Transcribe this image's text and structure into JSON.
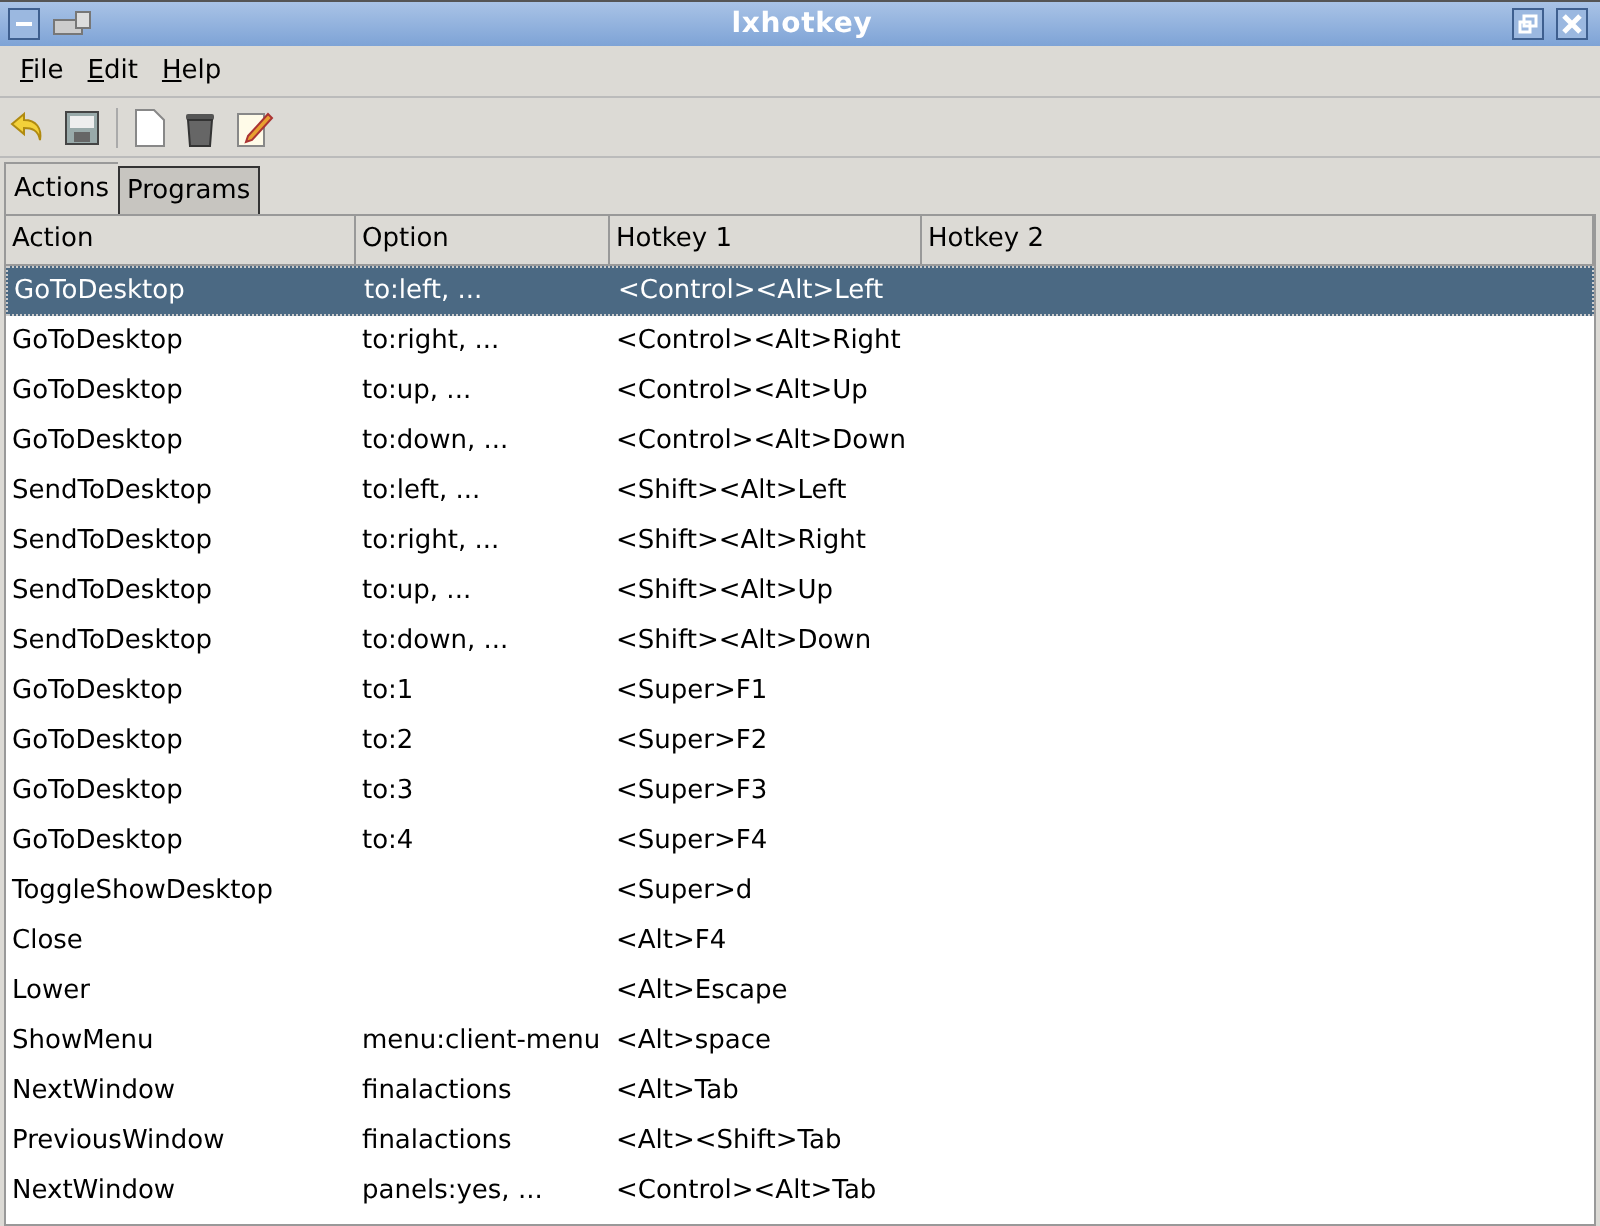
{
  "window": {
    "title": "lxhotkey"
  },
  "menu": [
    "File",
    "Edit",
    "Help"
  ],
  "tabs": [
    {
      "label": "Actions",
      "selected": true
    },
    {
      "label": "Programs",
      "selected": false
    }
  ],
  "table": {
    "columns": [
      "Action",
      "Option",
      "Hotkey 1",
      "Hotkey 2"
    ],
    "rows": [
      {
        "cells": [
          "GoToDesktop",
          "to:left, ...",
          "<Control><Alt>Left"
        ],
        "selected": true
      },
      {
        "cells": [
          "GoToDesktop",
          "to:right, ...",
          "<Control><Alt>Right"
        ],
        "selected": false
      },
      {
        "cells": [
          "GoToDesktop",
          "to:up, ...",
          "<Control><Alt>Up"
        ],
        "selected": false
      },
      {
        "cells": [
          "GoToDesktop",
          "to:down, ...",
          "<Control><Alt>Down"
        ],
        "selected": false
      },
      {
        "cells": [
          "SendToDesktop",
          "to:left, ...",
          "<Shift><Alt>Left"
        ],
        "selected": false
      },
      {
        "cells": [
          "SendToDesktop",
          "to:right, ...",
          "<Shift><Alt>Right"
        ],
        "selected": false
      },
      {
        "cells": [
          "SendToDesktop",
          "to:up, ...",
          "<Shift><Alt>Up"
        ],
        "selected": false
      },
      {
        "cells": [
          "SendToDesktop",
          "to:down, ...",
          "<Shift><Alt>Down"
        ],
        "selected": false
      },
      {
        "cells": [
          "GoToDesktop",
          "to:1",
          "<Super>F1"
        ],
        "selected": false
      },
      {
        "cells": [
          "GoToDesktop",
          "to:2",
          "<Super>F2"
        ],
        "selected": false
      },
      {
        "cells": [
          "GoToDesktop",
          "to:3",
          "<Super>F3"
        ],
        "selected": false
      },
      {
        "cells": [
          "GoToDesktop",
          "to:4",
          "<Super>F4"
        ],
        "selected": false
      },
      {
        "cells": [
          "ToggleShowDesktop",
          "",
          "<Super>d"
        ],
        "selected": false
      },
      {
        "cells": [
          "Close",
          "",
          "<Alt>F4"
        ],
        "selected": false
      },
      {
        "cells": [
          "Lower",
          "",
          "<Alt>Escape"
        ],
        "selected": false
      },
      {
        "cells": [
          "ShowMenu",
          "menu:client-menu",
          "<Alt>space"
        ],
        "selected": false
      },
      {
        "cells": [
          "NextWindow",
          "finalactions",
          "<Alt>Tab"
        ],
        "selected": false
      },
      {
        "cells": [
          "PreviousWindow",
          "finalactions",
          "<Alt><Shift>Tab"
        ],
        "selected": false
      },
      {
        "cells": [
          "NextWindow",
          "panels:yes, ...",
          "<Control><Alt>Tab"
        ],
        "selected": false
      }
    ]
  }
}
